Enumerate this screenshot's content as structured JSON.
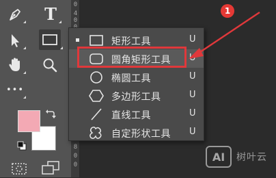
{
  "toolbar": {
    "tools": {
      "pen": "pen-icon",
      "type": "type-tool-icon",
      "type_label": "T",
      "select": "path-selection-icon",
      "shape": "rectangle-tool-icon",
      "hand": "hand-icon",
      "zoom": "zoom-icon",
      "more": "more-tools-icon",
      "more_label": "•••"
    },
    "foreground_color": "#f3a9b4",
    "background_color": "#ffffff"
  },
  "ruler": {
    "numbers": [
      "0",
      "4",
      "0",
      "0",
      "8",
      "0",
      "0"
    ]
  },
  "flyout": {
    "items": [
      {
        "label": "矩形工具",
        "shortcut": "U",
        "icon": "rectangle-icon",
        "selected": true
      },
      {
        "label": "圆角矩形工具",
        "shortcut": "U",
        "icon": "rounded-rectangle-icon",
        "selected": false
      },
      {
        "label": "椭圆工具",
        "shortcut": "U",
        "icon": "ellipse-icon",
        "selected": false
      },
      {
        "label": "多边形工具",
        "shortcut": "U",
        "icon": "polygon-icon",
        "selected": false
      },
      {
        "label": "直线工具",
        "shortcut": "U",
        "icon": "line-icon",
        "selected": false
      },
      {
        "label": "自定形状工具",
        "shortcut": "U",
        "icon": "custom-shape-icon",
        "selected": false
      }
    ]
  },
  "annotation": {
    "badge": "1",
    "color": "#e0383b"
  },
  "watermark": {
    "logo": "AI",
    "text": "树叶云"
  }
}
